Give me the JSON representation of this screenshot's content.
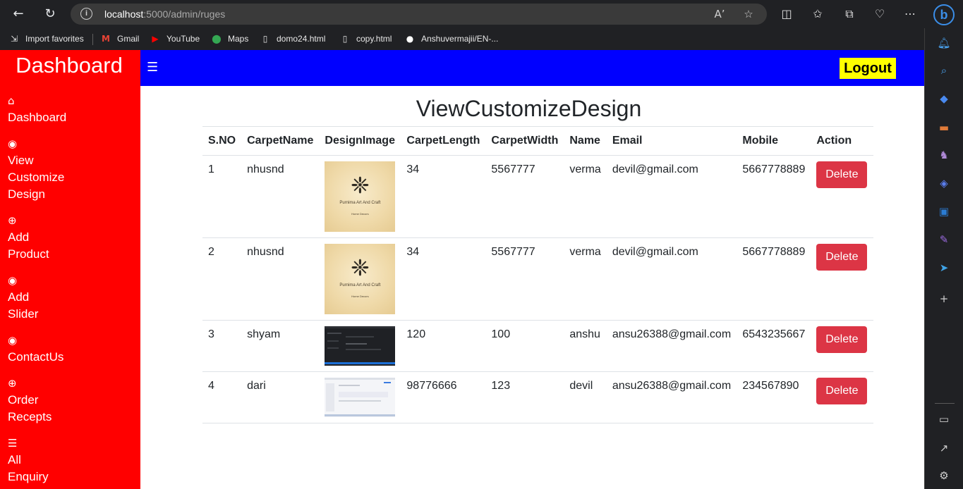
{
  "browser": {
    "url_host": "localhost",
    "url_rest": ":5000/admin/ruges",
    "bookmarks": [
      "Import favorites",
      "Gmail",
      "YouTube",
      "Maps",
      "domo24.html",
      "copy.html",
      "Anshuvermajii/EN-..."
    ]
  },
  "sidebar": {
    "brand": "Dashboard",
    "items": [
      {
        "icon": "home-icon",
        "lines": [
          "Dashboard"
        ]
      },
      {
        "icon": "eye-icon",
        "lines": [
          "View",
          "Customize",
          "Design"
        ]
      },
      {
        "icon": "plus-circle-icon",
        "lines": [
          "Add",
          "Product"
        ]
      },
      {
        "icon": "eye-icon",
        "lines": [
          "Add",
          "Slider"
        ]
      },
      {
        "icon": "eye-icon",
        "lines": [
          "ContactUs"
        ]
      },
      {
        "icon": "plus-circle-icon",
        "lines": [
          "Order",
          "Recepts"
        ]
      },
      {
        "icon": "list-icon",
        "lines": [
          "All",
          "Enquiry"
        ]
      }
    ]
  },
  "header": {
    "menu_icon": "hamburger-icon",
    "logout_label": "Logout"
  },
  "main": {
    "title": "ViewCustomizeDesign",
    "columns": [
      "S.NO",
      "CarpetName",
      "DesignImage",
      "CarpetLength",
      "CarpetWidth",
      "Name",
      "Email",
      "Mobile",
      "Action"
    ],
    "rows": [
      {
        "sno": "1",
        "carpet_name": "nhusnd",
        "image_caption": "Purnima Art And Craft",
        "image_subcaption": "Home Decors",
        "length": "34",
        "width": "5567777",
        "name": "verma",
        "email": "devil@gmail.com",
        "mobile": "5667778889",
        "action": "Delete"
      },
      {
        "sno": "2",
        "carpet_name": "nhusnd",
        "image_caption": "Purnima Art And Craft",
        "image_subcaption": "Home Decors",
        "length": "34",
        "width": "5567777",
        "name": "verma",
        "email": "devil@gmail.com",
        "mobile": "5667778889",
        "action": "Delete"
      },
      {
        "sno": "3",
        "carpet_name": "shyam",
        "length": "120",
        "width": "100",
        "name": "anshu",
        "email": "ansu26388@gmail.com",
        "mobile": "6543235667",
        "action": "Delete"
      },
      {
        "sno": "4",
        "carpet_name": "dari",
        "length": "98776666",
        "width": "123",
        "name": "devil",
        "email": "ansu26388@gmail.com",
        "mobile": "234567890",
        "action": "Delete"
      }
    ]
  },
  "colors": {
    "sidebar_bg": "#ff0000",
    "header_bg": "#0000ff",
    "logout_bg": "#ffff00",
    "delete_bg": "#dc3545"
  }
}
